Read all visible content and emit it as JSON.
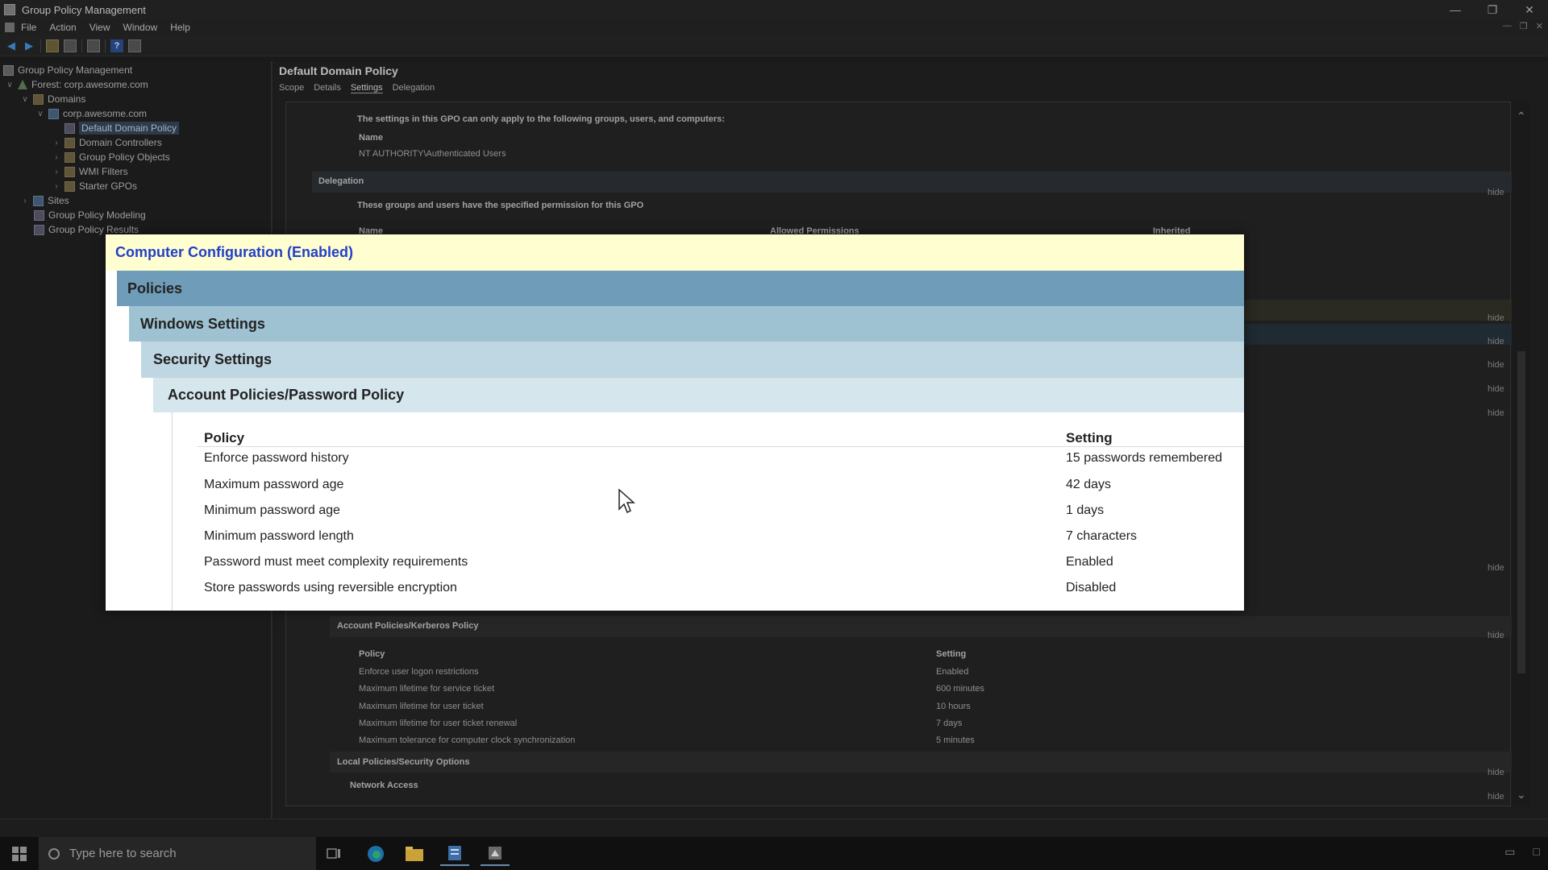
{
  "window": {
    "title": "Group Policy Management",
    "controls": {
      "minimize": "—",
      "restore": "❐",
      "close": "✕"
    }
  },
  "menu": {
    "items": [
      "File",
      "Action",
      "View",
      "Window",
      "Help"
    ]
  },
  "tree": {
    "root": "Group Policy Management",
    "forest": "Forest: corp.awesome.com",
    "domains": "Domains",
    "domain": "corp.awesome.com",
    "default_policy": "Default Domain Policy",
    "domain_controllers": "Domain Controllers",
    "gpo_objects": "Group Policy Objects",
    "wmi_filters": "WMI Filters",
    "starter_gpos": "Starter GPOs",
    "sites": "Sites",
    "modeling": "Group Policy Modeling",
    "results": "Group Policy Results"
  },
  "pane": {
    "title": "Default Domain Policy",
    "tabs": [
      "Scope",
      "Details",
      "Settings",
      "Delegation"
    ],
    "active_tab": "Settings"
  },
  "report_bg": {
    "security_filter_note": "The settings in this GPO can only apply to the following groups, users, and computers:",
    "name_header": "Name",
    "auth_users": "NT AUTHORITY\\Authenticated Users",
    "delegation_header": "Delegation",
    "delegation_note": "These groups and users have the specified permission for this GPO",
    "perm_headers": [
      "Name",
      "Allowed Permissions",
      "Inherited"
    ],
    "hide_label": "hide",
    "kerberos_section": "Account Policies/Kerberos Policy",
    "kerberos_headers": {
      "policy": "Policy",
      "setting": "Setting"
    },
    "kerberos_rows": [
      {
        "policy": "Enforce user logon restrictions",
        "setting": "Enabled"
      },
      {
        "policy": "Maximum lifetime for service ticket",
        "setting": "600 minutes"
      },
      {
        "policy": "Maximum lifetime for user ticket",
        "setting": "10 hours"
      },
      {
        "policy": "Maximum lifetime for user ticket renewal",
        "setting": "7 days"
      },
      {
        "policy": "Maximum tolerance for computer clock synchronization",
        "setting": "5 minutes"
      }
    ],
    "local_policies": "Local Policies/Security Options",
    "network_access": "Network Access"
  },
  "overlay": {
    "computer_config": "Computer Configuration (Enabled)",
    "policies": "Policies",
    "windows_settings": "Windows Settings",
    "security_settings": "Security Settings",
    "section": "Account Policies/Password Policy",
    "headers": {
      "policy": "Policy",
      "setting": "Setting"
    },
    "rows": [
      {
        "policy": "Enforce password history",
        "setting": "15 passwords remembered"
      },
      {
        "policy": "Maximum password age",
        "setting": "42 days"
      },
      {
        "policy": "Minimum password age",
        "setting": "1 days"
      },
      {
        "policy": "Minimum password length",
        "setting": "7 characters"
      },
      {
        "policy": "Password must meet complexity requirements",
        "setting": "Enabled"
      },
      {
        "policy": "Store passwords using reversible encryption",
        "setting": "Disabled"
      }
    ]
  },
  "taskbar": {
    "search_placeholder": "Type here to search"
  },
  "colors": {
    "cc_header_bg": "#fefed0",
    "cc_header_text": "#2340c8",
    "band_policies": "#6f9cb8",
    "band_windows": "#9ec2d2",
    "band_security": "#bed7e2",
    "band_section": "#d5e6ed"
  }
}
